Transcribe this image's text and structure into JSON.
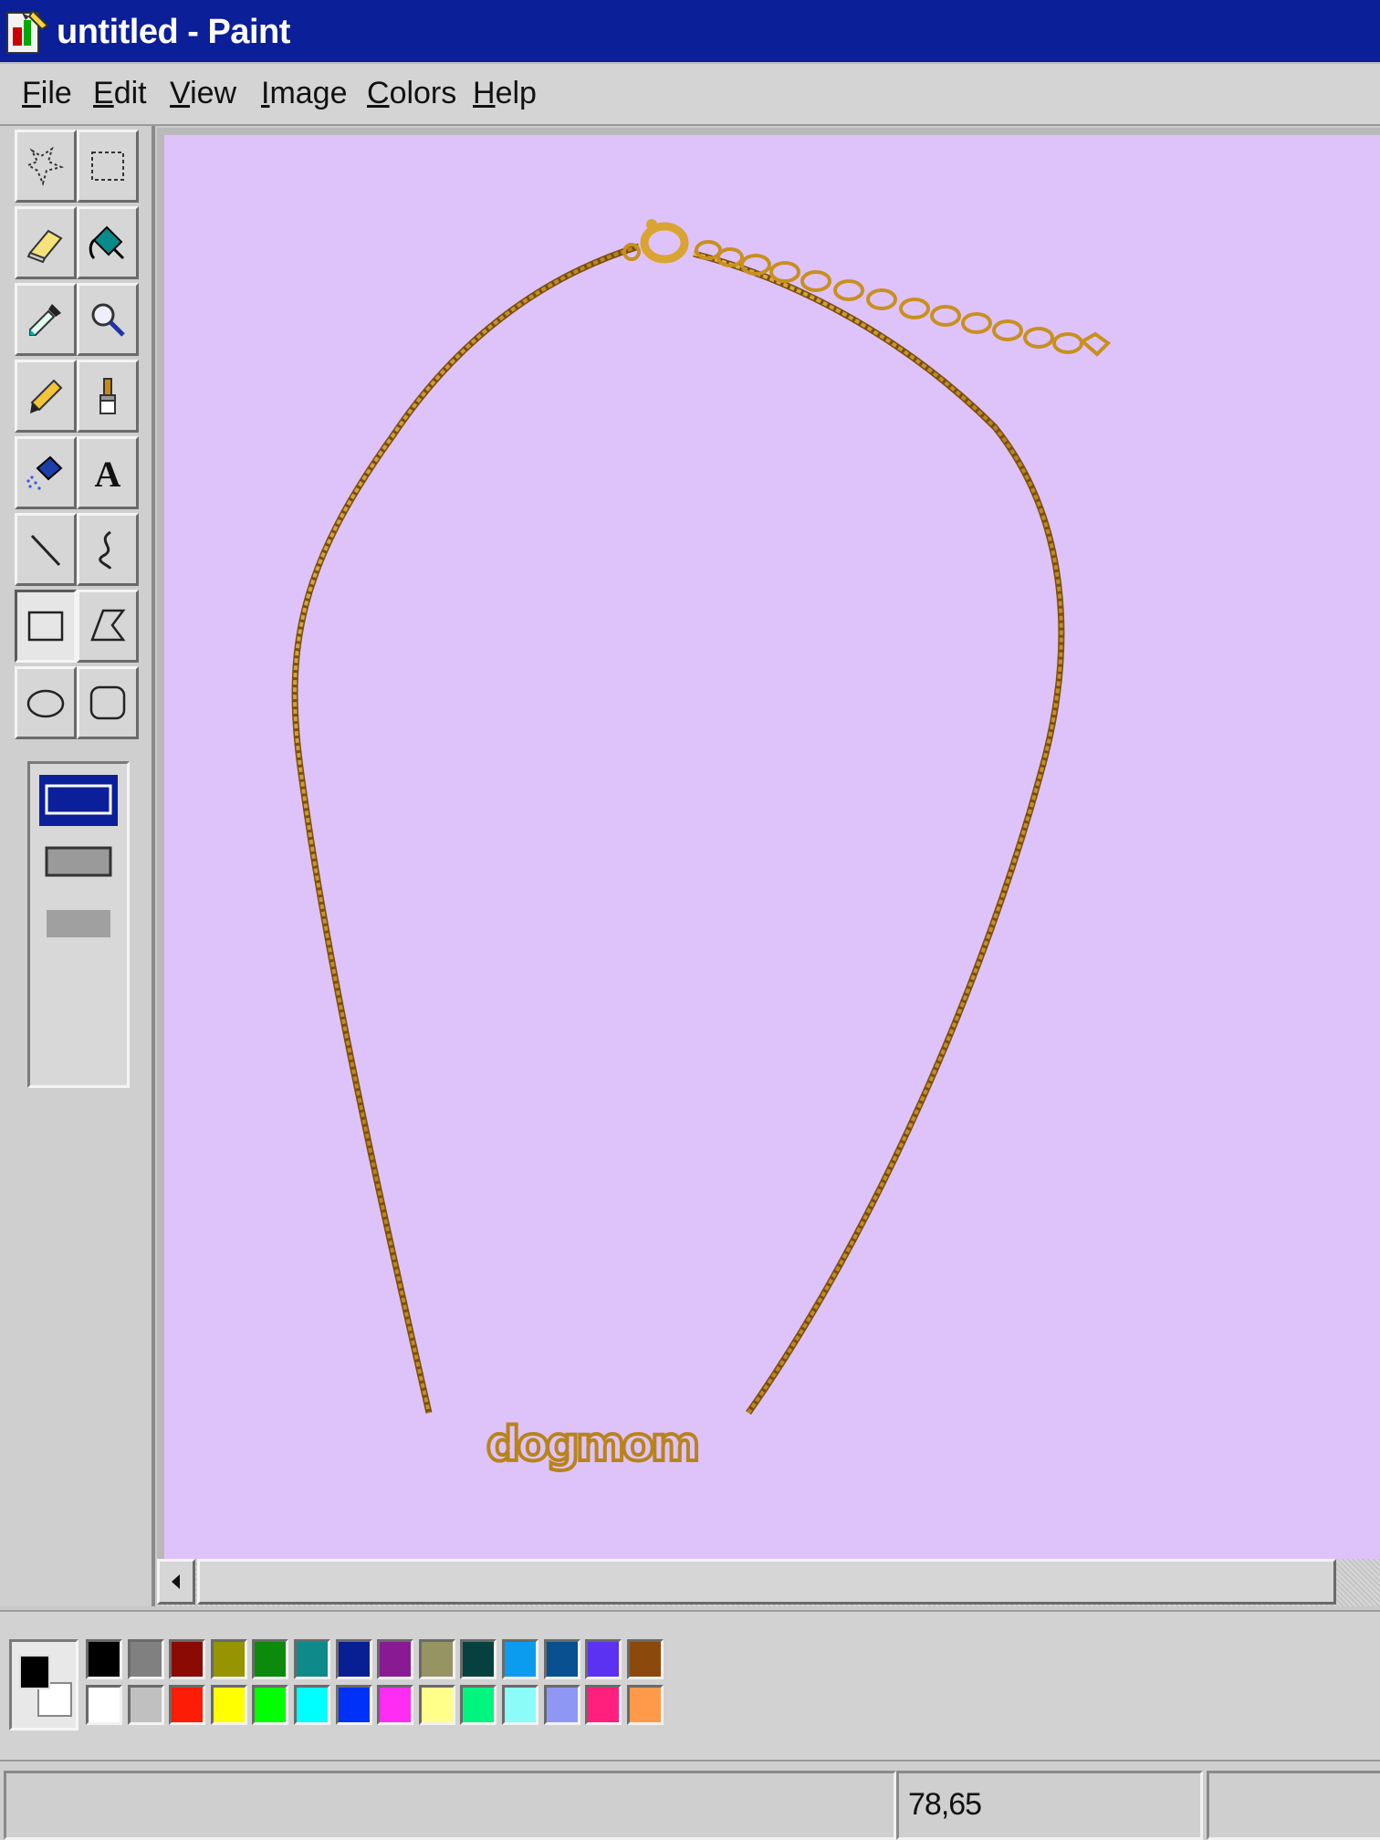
{
  "window": {
    "title": "untitled - Paint"
  },
  "menu": [
    "File",
    "Edit",
    "View",
    "Image",
    "Colors",
    "Help"
  ],
  "tools": [
    {
      "name": "free-form-select-icon"
    },
    {
      "name": "select-icon"
    },
    {
      "name": "eraser-icon"
    },
    {
      "name": "fill-bucket-icon"
    },
    {
      "name": "color-picker-icon"
    },
    {
      "name": "magnifier-icon"
    },
    {
      "name": "pencil-icon"
    },
    {
      "name": "brush-icon"
    },
    {
      "name": "airbrush-icon"
    },
    {
      "name": "text-icon"
    },
    {
      "name": "line-icon"
    },
    {
      "name": "curve-icon"
    },
    {
      "name": "rectangle-icon",
      "active": true
    },
    {
      "name": "polygon-icon"
    },
    {
      "name": "ellipse-icon"
    },
    {
      "name": "rounded-rectangle-icon"
    }
  ],
  "canvas": {
    "background": "#dec3fb",
    "pendant_text": "dogmom",
    "chain_color": "#c88f1e"
  },
  "colors": {
    "foreground": "#000000",
    "background": "#ffffff",
    "palette_top": [
      "#000000",
      "#808080",
      "#8b0a03",
      "#969400",
      "#0b8a0b",
      "#0e8a8a",
      "#071f93",
      "#8a1a93",
      "#969462",
      "#06413f",
      "#0b9cf0",
      "#085090",
      "#5b31f2",
      "#8b4a0c"
    ],
    "palette_bottom": [
      "#ffffff",
      "#c0c0c0",
      "#fd1c05",
      "#ffff00",
      "#00ff00",
      "#00ffff",
      "#0031f8",
      "#ff2cf4",
      "#ffff8a",
      "#00f57e",
      "#8cfcf9",
      "#8e98f4",
      "#ff1f7c",
      "#ff9a4a"
    ]
  },
  "status": {
    "coordinates": "78,65"
  }
}
